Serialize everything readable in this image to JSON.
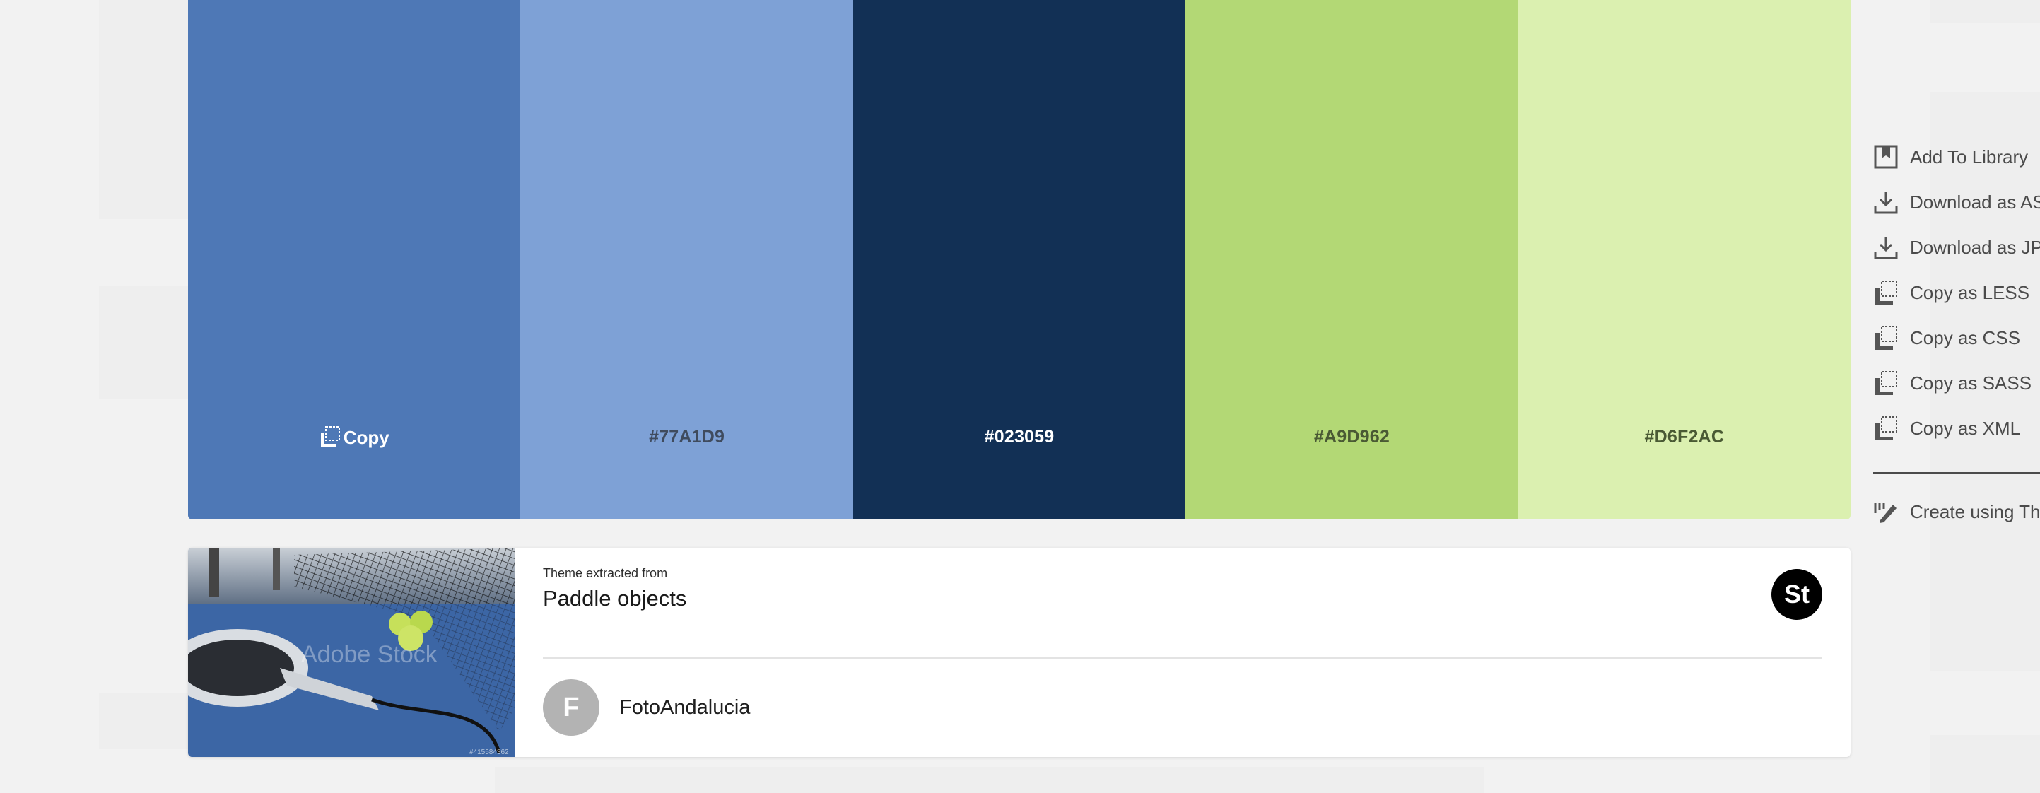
{
  "palette": {
    "swatches": [
      {
        "color": "#4E78B6",
        "label": "Copy",
        "label_color": "#ffffff"
      },
      {
        "color": "#7EA1D6",
        "label": "#77A1D9",
        "label_color": "#3f4b5e"
      },
      {
        "color": "#123055",
        "label": "#023059",
        "label_color": "#ffffff"
      },
      {
        "color": "#B3D875",
        "label": "#A9D962",
        "label_color": "#4a5a34"
      },
      {
        "color": "#DBF0B0",
        "label": "#D6F2AC",
        "label_color": "#4a5a34"
      }
    ]
  },
  "source": {
    "extracted_label": "Theme extracted from",
    "title": "Paddle objects",
    "badge": "St",
    "watermark": "Adobe Stock",
    "image_id": "#415584362",
    "author_initial": "F",
    "author_name": "FotoAndalucia"
  },
  "actions": {
    "items": [
      {
        "label": "Add To Library",
        "icon": "library-icon"
      },
      {
        "label": "Download as ASE",
        "icon": "download-icon"
      },
      {
        "label": "Download as JPEG",
        "icon": "download-icon"
      },
      {
        "label": "Copy as LESS",
        "icon": "copy-icon"
      },
      {
        "label": "Copy as CSS",
        "icon": "copy-icon"
      },
      {
        "label": "Copy as SASS",
        "icon": "copy-icon"
      },
      {
        "label": "Copy as XML",
        "icon": "copy-icon"
      }
    ],
    "create_label": "Create using Theme"
  }
}
